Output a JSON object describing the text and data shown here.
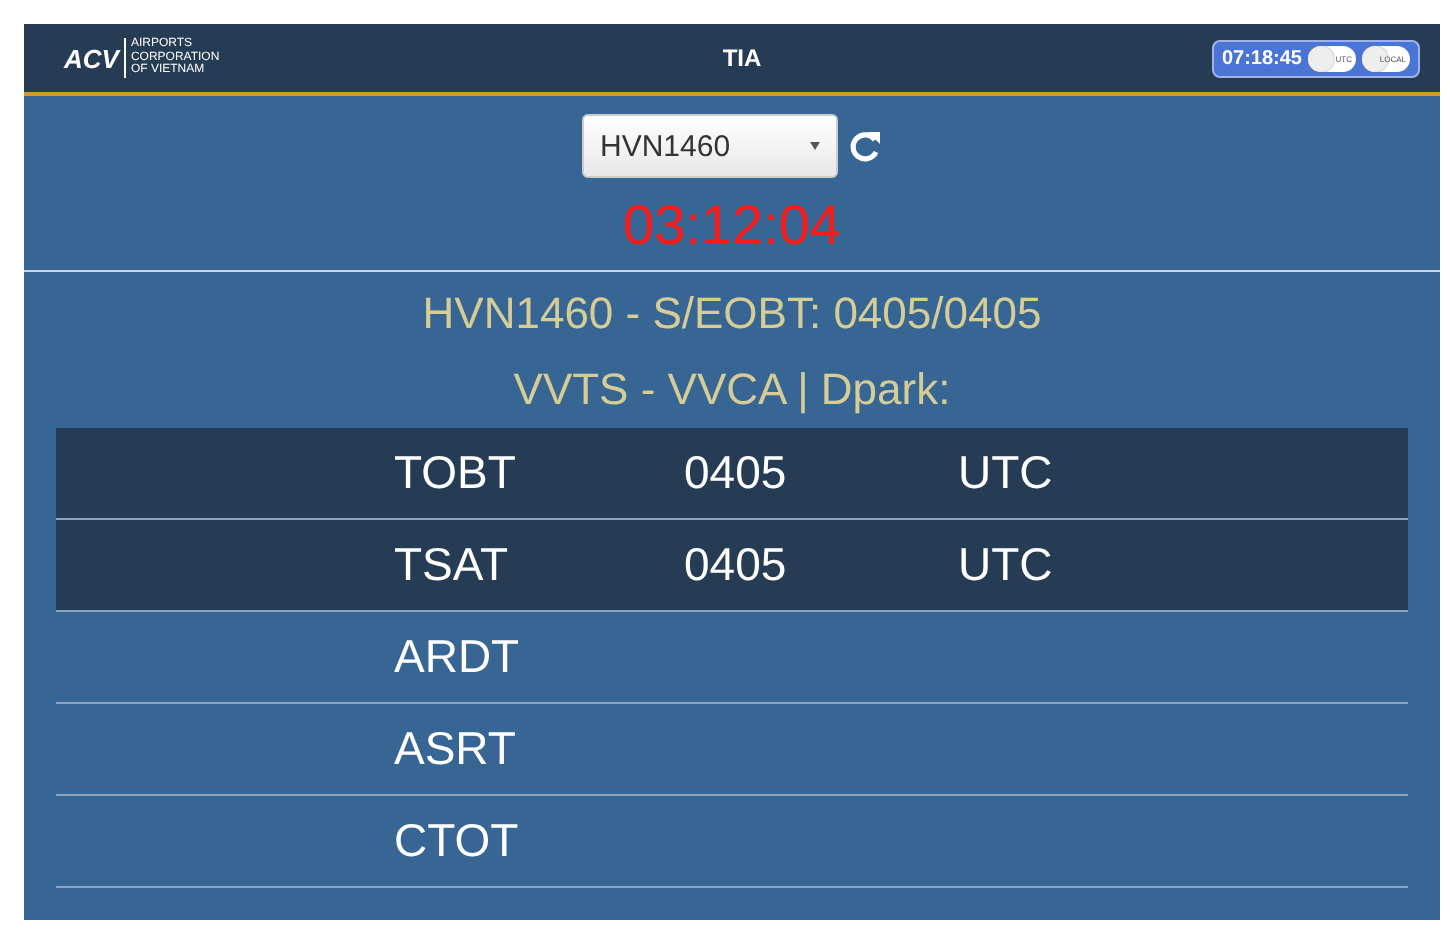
{
  "header": {
    "logo": "ACV",
    "logo_subtitle": [
      "AIRPORTS",
      "CORPORATION",
      "OF VIETNAM"
    ],
    "title": "TIA",
    "clock": "07:18:45",
    "toggles": [
      {
        "label": "UTC",
        "on": false
      },
      {
        "label": "LOCAL",
        "on": false
      }
    ]
  },
  "flight_select": {
    "value": "HVN1460"
  },
  "countdown": "03:12:04",
  "flight_info": "HVN1460 - S/EOBT: 0405/0405",
  "route_info": "VVTS - VVCA | Dpark:",
  "rows": [
    {
      "name": "TOBT",
      "time": "0405",
      "zone": "UTC",
      "highlighted": true
    },
    {
      "name": "TSAT",
      "time": "0405",
      "zone": "UTC",
      "highlighted": true
    },
    {
      "name": "ARDT",
      "highlighted": false
    },
    {
      "name": "ASRT",
      "highlighted": false
    },
    {
      "name": "CTOT",
      "highlighted": false
    }
  ]
}
